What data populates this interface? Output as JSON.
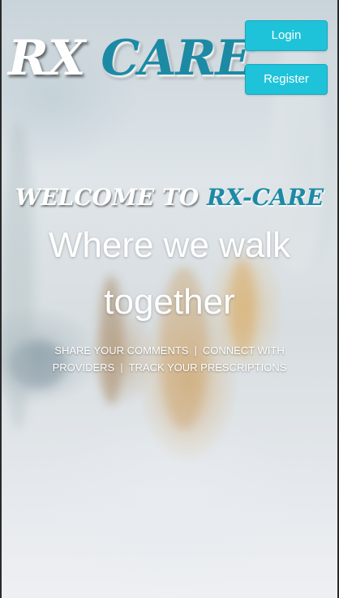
{
  "header": {
    "logo_part1": "RX",
    "logo_part2": "CARE",
    "login_label": "Login",
    "register_label": "Register"
  },
  "hero": {
    "welcome_part1": "WELCOME TO",
    "welcome_part2": "RX-CARE",
    "tagline": "Where we walk together",
    "features": [
      "SHARE YOUR COMMENTS",
      "CONNECT WITH PROVIDERS",
      "TRACK YOUR PRESCRIPTIONS"
    ],
    "separator": "|"
  },
  "colors": {
    "accent": "#1fc3d9",
    "brand_teal": "#1c8aa5",
    "text_light": "#ffffff"
  }
}
